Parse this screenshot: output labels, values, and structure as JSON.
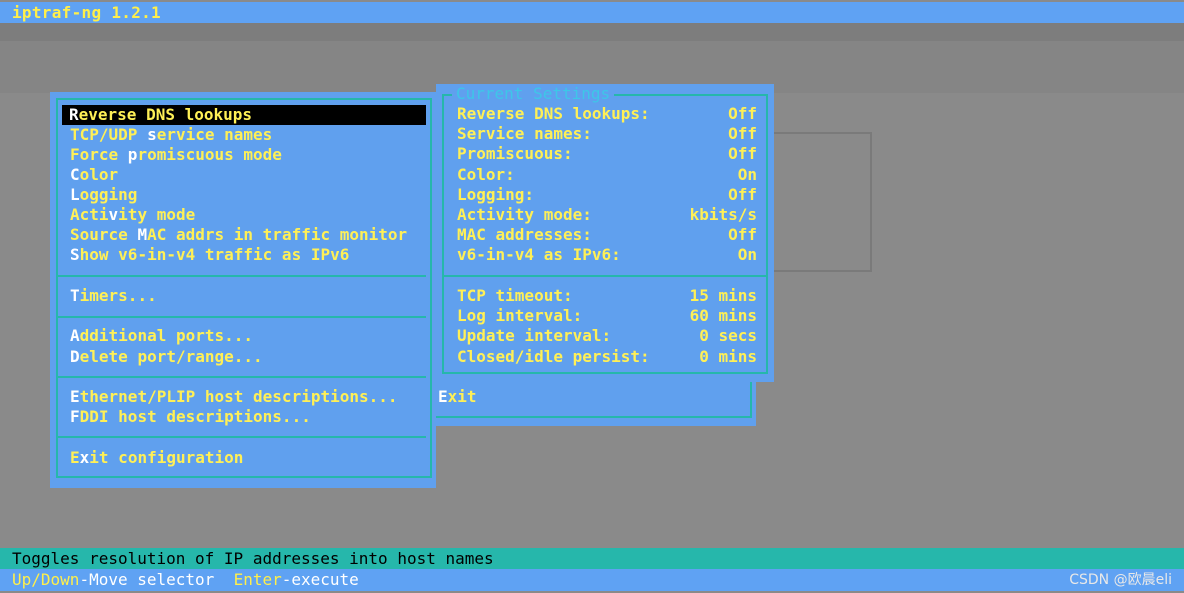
{
  "window": {
    "title": "iptraf-ng 1.2.1"
  },
  "menu": {
    "items": [
      {
        "hotkey": "R",
        "rest": "everse DNS lookups",
        "pre": ""
      },
      {
        "pre": "TCP/UDP ",
        "hotkey": "s",
        "rest": "ervice names"
      },
      {
        "pre": "Force ",
        "hotkey": "p",
        "rest": "romiscuous mode"
      },
      {
        "pre": "",
        "hotkey": "C",
        "rest": "olor"
      },
      {
        "pre": "",
        "hotkey": "L",
        "rest": "ogging"
      },
      {
        "pre": "Acti",
        "hotkey": "v",
        "rest": "ity mode"
      },
      {
        "pre": "Source ",
        "hotkey": "M",
        "rest": "AC addrs in traffic monitor"
      },
      {
        "pre": "",
        "hotkey": "S",
        "rest": "how v6-in-v4 traffic as IPv6"
      },
      {
        "pre": "",
        "hotkey": "T",
        "rest": "imers..."
      },
      {
        "pre": "",
        "hotkey": "A",
        "rest": "dditional ports..."
      },
      {
        "pre": "",
        "hotkey": "D",
        "rest": "elete port/range..."
      },
      {
        "pre": "",
        "hotkey": "E",
        "rest": "thernet/PLIP host descriptions..."
      },
      {
        "pre": "",
        "hotkey": "F",
        "rest": "DDI host descriptions..."
      },
      {
        "pre": "E",
        "hotkey": "x",
        "rest": "it configuration"
      }
    ],
    "selected_label": "Reverse DNS lookups"
  },
  "settings": {
    "title": "Current Settings",
    "rows": [
      {
        "label": "Reverse DNS lookups:",
        "value": "Off"
      },
      {
        "label": "Service names:",
        "value": "Off"
      },
      {
        "label": "Promiscuous:",
        "value": "Off"
      },
      {
        "label": "Color:",
        "value": "On"
      },
      {
        "label": "Logging:",
        "value": "Off"
      },
      {
        "label": "Activity mode:",
        "value": "kbits/s"
      },
      {
        "label": "MAC addresses:",
        "value": "Off"
      },
      {
        "label": "v6-in-v4 as IPv6:",
        "value": "On"
      },
      {
        "label": "TCP timeout:",
        "value": "15 mins"
      },
      {
        "label": "Log interval:",
        "value": "60 mins"
      },
      {
        "label": "Update interval:",
        "value": "0 secs"
      },
      {
        "label": "Closed/idle persist:",
        "value": "0 mins"
      }
    ]
  },
  "exit_button": {
    "hotkey": "E",
    "rest": "xit"
  },
  "status": {
    "description": "Toggles resolution of IP addresses into host names",
    "keys": [
      {
        "key": "Up/Down",
        "desc": "-Move selector"
      },
      {
        "key": "Enter",
        "desc": "-execute"
      }
    ]
  },
  "watermark": "CSDN @欧晨eli",
  "colors": {
    "panel_bg": "#60a0ee",
    "text_yellow": "#fff056",
    "border_teal": "#26b7ab",
    "title_cyan": "#3ec6e8"
  }
}
